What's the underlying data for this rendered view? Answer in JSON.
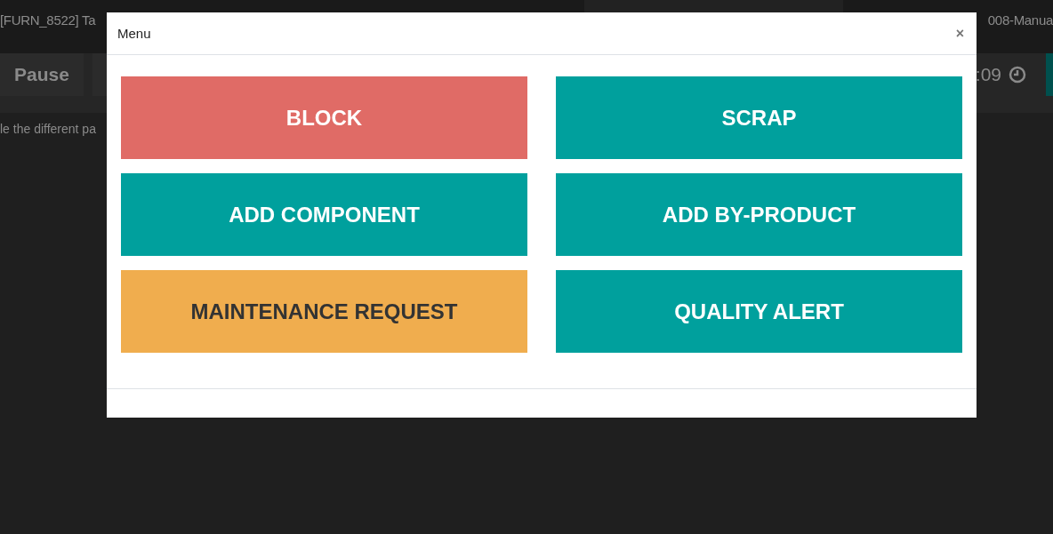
{
  "background": {
    "title": "[FURN_8522] Ta",
    "reference": "008-Manua",
    "pause_button": "Pause",
    "timer": ":09",
    "instruction": "le the different pa"
  },
  "modal": {
    "title": "Menu",
    "close": "×",
    "actions": [
      {
        "label": "BLOCK",
        "kind": "danger"
      },
      {
        "label": "SCRAP",
        "kind": "primary"
      },
      {
        "label": "ADD COMPONENT",
        "kind": "primary"
      },
      {
        "label": "ADD BY-PRODUCT",
        "kind": "primary"
      },
      {
        "label": "MAINTENANCE REQUEST",
        "kind": "warning"
      },
      {
        "label": "QUALITY ALERT",
        "kind": "primary"
      }
    ]
  }
}
